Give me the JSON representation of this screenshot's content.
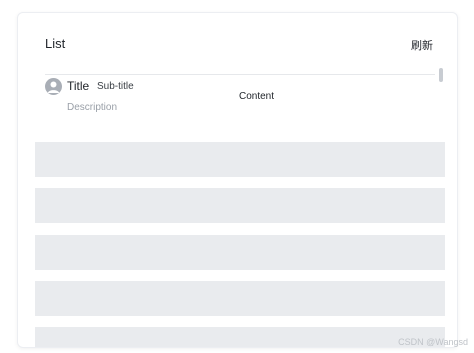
{
  "card": {
    "title": "List",
    "refresh_label": "刷新"
  },
  "item": {
    "avatar_icon": "user-avatar-icon",
    "title": "Title",
    "subtitle": "Sub-title",
    "description": "Description",
    "content": "Content"
  },
  "skeleton_rows": 5,
  "watermark": "CSDN @Wangsd",
  "colors": {
    "skeleton": "#e9ebee",
    "avatar": "#a9aeb6",
    "divider": "#e6e8eb"
  }
}
